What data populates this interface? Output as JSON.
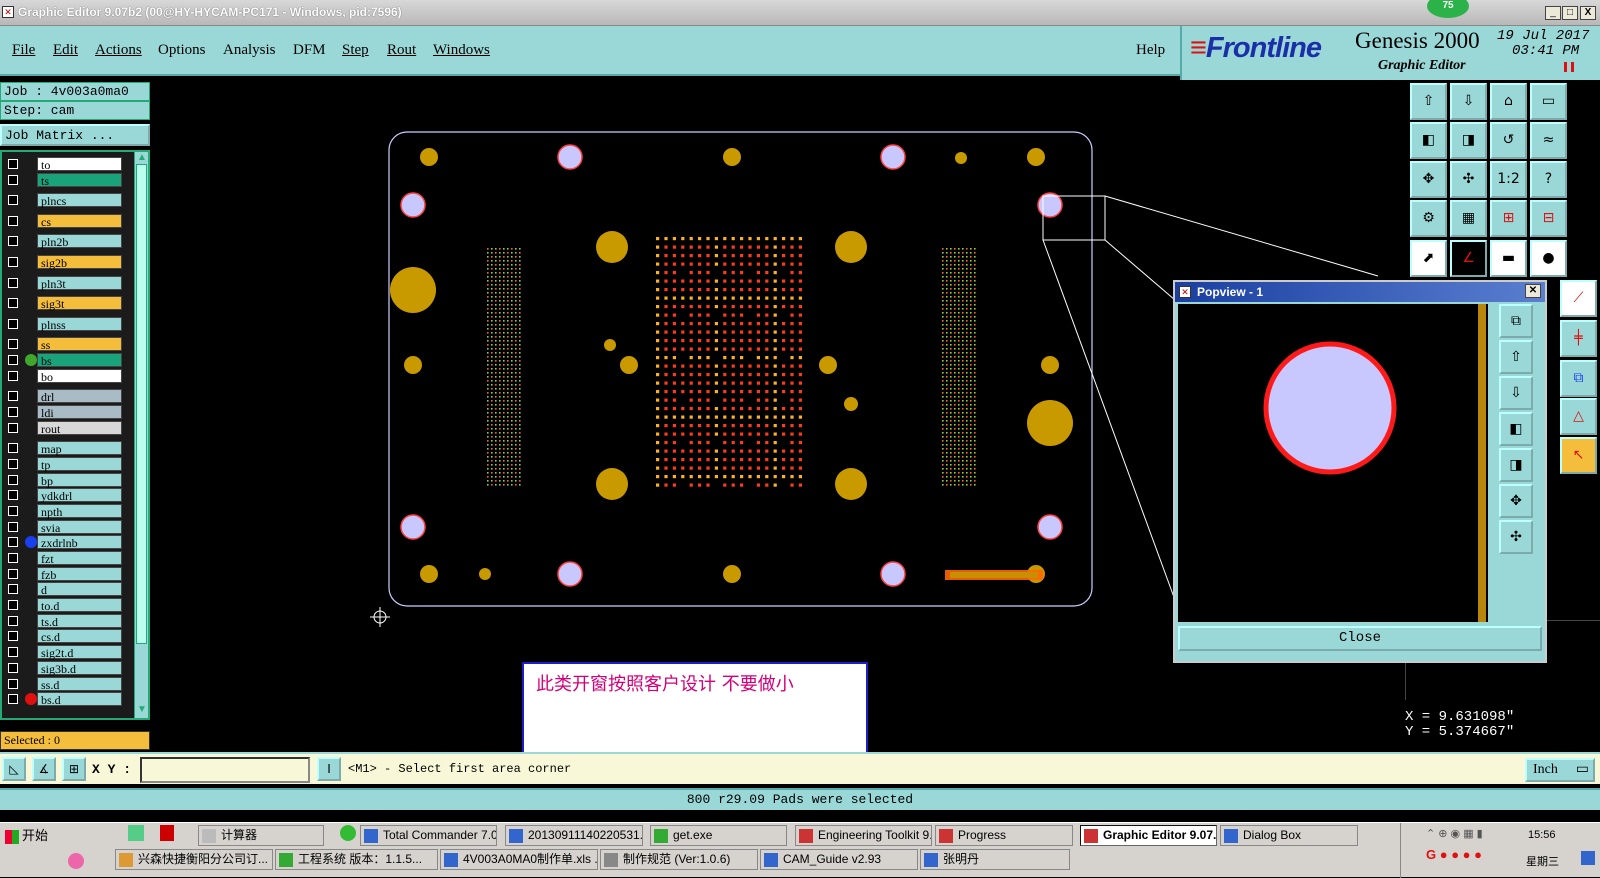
{
  "window": {
    "title": "Graphic Editor 9.07b2 (00@HY-HYCAM-PC171 - Windows, pid:7596)",
    "badge": "75",
    "controls": [
      "_",
      "□",
      "X"
    ]
  },
  "menu": {
    "items": [
      "File",
      "Edit",
      "Actions",
      "Options",
      "Analysis",
      "DFM",
      "Step",
      "Rout",
      "Windows"
    ],
    "help": "Help"
  },
  "brand": {
    "logo": "Frontline",
    "product": "Genesis 2000",
    "subtitle": "Graphic Editor",
    "date": "19 Jul 2017",
    "time": "03:41 PM"
  },
  "job": {
    "job_label": "Job : 4v003a0ma0",
    "step_label": "Step: cam",
    "matrix_button": "Job Matrix ..."
  },
  "layers": [
    {
      "name": "to",
      "color": "#ffffff"
    },
    {
      "name": "ts",
      "color": "#1aa37a"
    },
    {
      "name": "plncs",
      "color": "#9ad8d8"
    },
    {
      "name": "cs",
      "color": "#f5bd3c"
    },
    {
      "name": "pln2b",
      "color": "#9ad8d8"
    },
    {
      "name": "sig2b",
      "color": "#f5bd3c"
    },
    {
      "name": "pln3t",
      "color": "#9ad8d8"
    },
    {
      "name": "sig3t",
      "color": "#f5bd3c"
    },
    {
      "name": "plnss",
      "color": "#9ad8d8"
    },
    {
      "name": "ss",
      "color": "#f5bd3c"
    },
    {
      "name": "bs",
      "color": "#1aa37a",
      "marker": "#3fa82a"
    },
    {
      "name": "bo",
      "color": "#ffffff"
    },
    {
      "name": "drl",
      "color": "#a9bcc6"
    },
    {
      "name": "ldi",
      "color": "#a9bcc6"
    },
    {
      "name": "rout",
      "color": "#d8d8d8"
    },
    {
      "name": "map",
      "color": "#9ad8d8"
    },
    {
      "name": "tp",
      "color": "#9ad8d8"
    },
    {
      "name": "bp",
      "color": "#9ad8d8"
    },
    {
      "name": "ydkdrl",
      "color": "#9ad8d8"
    },
    {
      "name": "npth",
      "color": "#9ad8d8"
    },
    {
      "name": "svia",
      "color": "#9ad8d8"
    },
    {
      "name": "zxdrlnb",
      "color": "#9ad8d8",
      "marker": "#1a3ff0"
    },
    {
      "name": "fzt",
      "color": "#9ad8d8"
    },
    {
      "name": "fzb",
      "color": "#9ad8d8"
    },
    {
      "name": "d",
      "color": "#9ad8d8"
    },
    {
      "name": "to.d",
      "color": "#9ad8d8"
    },
    {
      "name": "ts.d",
      "color": "#9ad8d8"
    },
    {
      "name": "cs.d",
      "color": "#9ad8d8"
    },
    {
      "name": "sig2t.d",
      "color": "#9ad8d8"
    },
    {
      "name": "sig3b.d",
      "color": "#9ad8d8"
    },
    {
      "name": "ss.d",
      "color": "#9ad8d8"
    },
    {
      "name": "bs.d",
      "color": "#9ad8d8",
      "marker": "#e01010"
    }
  ],
  "selected_label": "Selected : 0",
  "coords": {
    "x": "X =  9.631098\"",
    "y": "Y =  5.374667\""
  },
  "cmd": {
    "xy_label": "X Y :",
    "prompt": "<M1> - Select first area corner",
    "units": "Inch"
  },
  "status": "800 r29.09 Pads were selected",
  "popview": {
    "title": "Popview - 1",
    "close": "Close"
  },
  "note": "此类开窗按照客户设计    不要做小",
  "taskbar": {
    "start": "开始",
    "row1": [
      "计算器",
      "Total Commander 7.0...",
      "20130911140220531...",
      "get.exe",
      "Engineering Toolkit 9....",
      "Progress",
      "Graphic Editor 9.07...",
      "Dialog Box"
    ],
    "row2": [
      "兴森快捷衡阳分公司订...",
      "工程系统  版本：1.1.5...",
      "4V003A0MA0制作单.xls ...",
      "制作规范 (Ver:1.0.6)",
      "CAM_Guide v2.93",
      "张明丹"
    ],
    "clock": "15:56",
    "day": "星期三"
  }
}
